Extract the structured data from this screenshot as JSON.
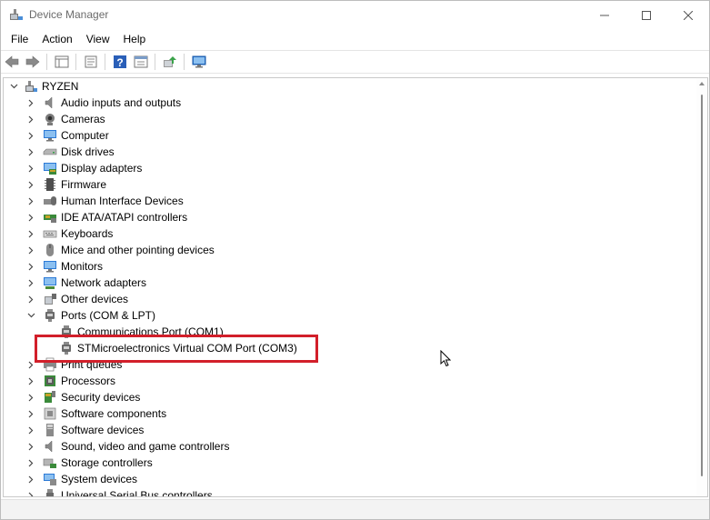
{
  "window": {
    "title": "Device Manager",
    "controls": {
      "minimize": "minimize",
      "maximize": "maximize",
      "close": "close"
    }
  },
  "menu": [
    "File",
    "Action",
    "View",
    "Help"
  ],
  "toolbar": {
    "buttons": [
      "back-icon",
      "forward-icon",
      "show-hide-tree-icon",
      "properties-icon",
      "help-icon",
      "action-view-icon",
      "update-driver-icon",
      "scan-hardware-icon"
    ]
  },
  "tree": {
    "root": "RYZEN",
    "categories": [
      {
        "label": "Audio inputs and outputs",
        "icon": "speaker-icon"
      },
      {
        "label": "Cameras",
        "icon": "camera-icon"
      },
      {
        "label": "Computer",
        "icon": "monitor-icon"
      },
      {
        "label": "Disk drives",
        "icon": "disk-drive-icon"
      },
      {
        "label": "Display adapters",
        "icon": "display-adapter-icon"
      },
      {
        "label": "Firmware",
        "icon": "chip-icon"
      },
      {
        "label": "Human Interface Devices",
        "icon": "hid-icon"
      },
      {
        "label": "IDE ATA/ATAPI controllers",
        "icon": "ide-controller-icon"
      },
      {
        "label": "Keyboards",
        "icon": "keyboard-icon"
      },
      {
        "label": "Mice and other pointing devices",
        "icon": "mouse-icon"
      },
      {
        "label": "Monitors",
        "icon": "monitor-icon"
      },
      {
        "label": "Network adapters",
        "icon": "network-adapter-icon"
      },
      {
        "label": "Other devices",
        "icon": "other-devices-icon"
      },
      {
        "label": "Ports (COM & LPT)",
        "icon": "port-icon",
        "expanded": true
      },
      {
        "label": "Communications Port (COM1)",
        "icon": "port-icon",
        "child": true
      },
      {
        "label": "STMicroelectronics Virtual COM Port (COM3)",
        "icon": "port-icon",
        "child": true,
        "highlighted": true
      },
      {
        "label": "Print queues",
        "icon": "printer-icon"
      },
      {
        "label": "Processors",
        "icon": "processor-icon"
      },
      {
        "label": "Security devices",
        "icon": "security-device-icon"
      },
      {
        "label": "Software components",
        "icon": "software-component-icon"
      },
      {
        "label": "Software devices",
        "icon": "software-device-icon"
      },
      {
        "label": "Sound, video and game controllers",
        "icon": "sound-icon"
      },
      {
        "label": "Storage controllers",
        "icon": "storage-controller-icon"
      },
      {
        "label": "System devices",
        "icon": "system-devices-icon"
      },
      {
        "label": "Universal Serial Bus controllers",
        "icon": "usb-icon"
      }
    ]
  },
  "colors": {
    "highlight_border": "#d21f2a",
    "accent_blue": "#2b79d6",
    "icon_gray": "#6a6a6a"
  }
}
